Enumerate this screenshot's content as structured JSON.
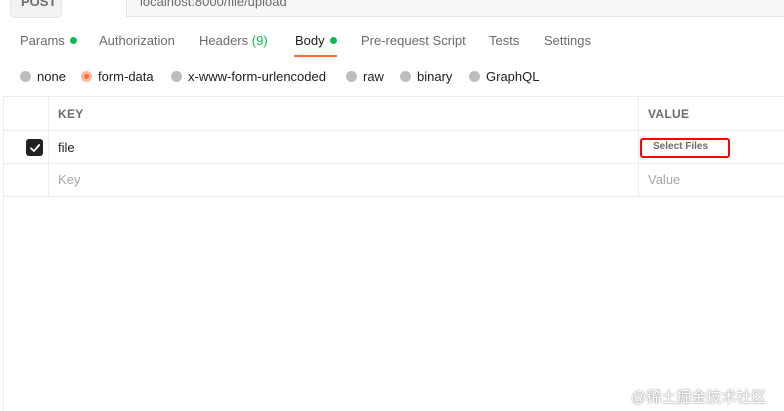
{
  "request": {
    "method": "POST",
    "url": "localhost:8000/file/upload"
  },
  "tabs": [
    {
      "label": "Params",
      "indicator": "dot"
    },
    {
      "label": "Authorization"
    },
    {
      "label": "Headers",
      "count": "(9)"
    },
    {
      "label": "Body",
      "indicator": "dot",
      "active": true
    },
    {
      "label": "Pre-request Script"
    },
    {
      "label": "Tests"
    },
    {
      "label": "Settings"
    }
  ],
  "body_types": [
    {
      "label": "none"
    },
    {
      "label": "form-data",
      "selected": true
    },
    {
      "label": "x-www-form-urlencoded"
    },
    {
      "label": "raw"
    },
    {
      "label": "binary"
    },
    {
      "label": "GraphQL"
    }
  ],
  "table": {
    "headers": {
      "key": "KEY",
      "value": "VALUE"
    },
    "rows": [
      {
        "checked": true,
        "key": "file",
        "value_button": "Select Files"
      }
    ],
    "new_row": {
      "key_placeholder": "Key",
      "value_placeholder": "Value"
    }
  },
  "watermark": "@稀土掘金技术社区",
  "colors": {
    "accent": "#ff6c37",
    "indicator_green": "#0cbb52",
    "highlight_red": "#ff0000"
  }
}
